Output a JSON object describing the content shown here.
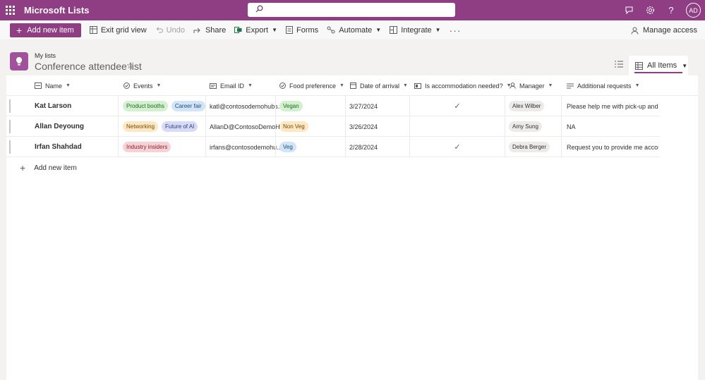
{
  "app": {
    "title": "Microsoft Lists",
    "user_initials": "AD"
  },
  "icons": [
    "waffle-icon",
    "search-icon",
    "feedback-icon",
    "gear-icon",
    "help-icon",
    "grid-icon",
    "undo-icon",
    "share-icon",
    "export-icon",
    "forms-icon",
    "automate-icon",
    "integrate-icon",
    "person-icon",
    "list-icon",
    "star-icon",
    "view-switch-icon",
    "table-icon",
    "calendar-icon",
    "check-icon",
    "text-icon",
    "email-icon",
    "choice-icon"
  ],
  "colors": {
    "brand": "#8f3e83",
    "list_icon": "#a0539a"
  },
  "toolbar": {
    "add_new_item": "Add new item",
    "exit_grid_view": "Exit grid view",
    "undo": "Undo",
    "share": "Share",
    "export": "Export",
    "forms": "Forms",
    "automate": "Automate",
    "integrate": "Integrate",
    "more": "···",
    "manage_access": "Manage access"
  },
  "list": {
    "breadcrumb": "My lists",
    "title": "Conference attendee list",
    "view_name": "All Items"
  },
  "columns": [
    {
      "label": "Name"
    },
    {
      "label": "Events"
    },
    {
      "label": "Email ID"
    },
    {
      "label": "Food preference"
    },
    {
      "label": "Date of arrival"
    },
    {
      "label": "Is accommodation needed?"
    },
    {
      "label": "Manager"
    },
    {
      "label": "Additional requests"
    }
  ],
  "rows": [
    {
      "name": "Kat Larson",
      "events": [
        {
          "label": "Product booths",
          "color": "#d3f0d0"
        },
        {
          "label": "Career fair",
          "color": "#d2e4f7"
        }
      ],
      "email": "katl@contosodemohubs...",
      "food": {
        "label": "Vegan",
        "color": "#d3f0d0"
      },
      "date": "3/27/2024",
      "accommodation": "✓",
      "manager": "Alex Wilber",
      "requests": "Please help me with pick-up and dro..."
    },
    {
      "name": "Allan Deyoung",
      "events": [
        {
          "label": "Networking",
          "color": "#fde7c4"
        },
        {
          "label": "Future of AI",
          "color": "#d6dcf7"
        }
      ],
      "email": "AllanD@ContosoDemoH...",
      "food": {
        "label": "Non Veg",
        "color": "#fde7c4"
      },
      "date": "3/26/2024",
      "accommodation": "",
      "manager": "Amy Sung",
      "requests": "NA"
    },
    {
      "name": "Irfan Shahdad",
      "events": [
        {
          "label": "Industry insiders",
          "color": "#f7d2d5"
        }
      ],
      "email": "irfans@contosodemohu...",
      "food": {
        "label": "Veg",
        "color": "#d2e4f7"
      },
      "date": "2/28/2024",
      "accommodation": "✓",
      "manager": "Debra Berger",
      "requests": "Request you to provide me accomm..."
    }
  ],
  "add_row_label": "Add new item"
}
